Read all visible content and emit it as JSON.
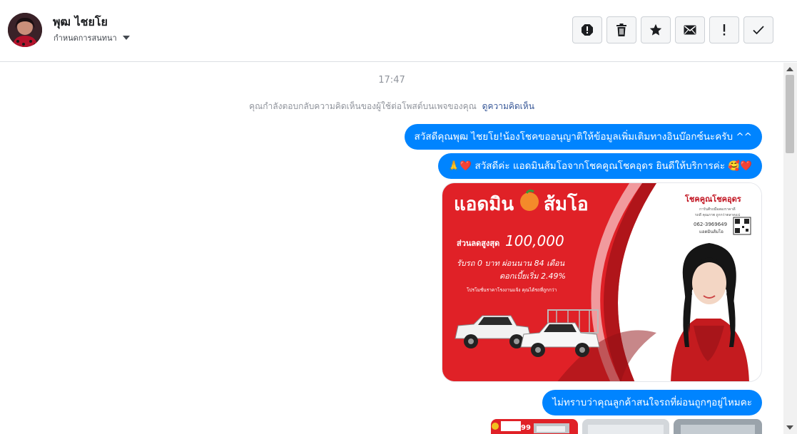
{
  "header": {
    "name": "พุฒ ไชยโย",
    "subtitle": "กำหนดการสนทนา",
    "actions": [
      {
        "icon": "alert-circle-icon",
        "name": "report-button"
      },
      {
        "icon": "trash-icon",
        "name": "delete-button"
      },
      {
        "icon": "star-icon",
        "name": "star-button"
      },
      {
        "icon": "envelope-icon",
        "name": "mark-unread-button"
      },
      {
        "icon": "exclamation-icon",
        "name": "spam-button"
      },
      {
        "icon": "check-icon",
        "name": "done-button"
      }
    ]
  },
  "thread": {
    "timestamp": "17:47",
    "context_text": "คุณกำลังตอบกลับความคิดเห็นของผู้ใช้ต่อโพสต์บนเพจของคุณ",
    "context_link": "ดูความคิดเห็น",
    "messages": [
      {
        "text": "สวัสดีคุณพุฒ ไชยโย!น้องโชคขออนุญาติให้ข้อมูลเพิ่มเติมทางอินบ๊อกซ์นะครับ ^^"
      },
      {
        "text": "🙏❤️ สวัสดีค่ะ แอดมินส้มโอจากโชคคูณโชคอุดร ยินดีให้บริการค่ะ 🥰❤️"
      },
      {
        "text": "ไม่ทราบว่าคุณลูกค้าสนใจรถที่ผ่อนถูกๆอยู่ไหมคะ"
      }
    ],
    "promo": {
      "brand": "โชคคูณโชคอุดร",
      "brand_sub": "การันตีรถมือสองราคาดี",
      "brand_sub2": "รถดี คุณภาพ ถูกกว่าตลาดแน่",
      "phone": "062-3969649",
      "admin": "แอดมินส้มโอ",
      "headline_left": "แอดมิน",
      "headline_right": "ส้มโอ",
      "discount_label": "ส่วนลดสูงสุด",
      "discount_value": "100,000",
      "line2": "รับรถ 0 บาท ผ่อนนาน 84 เดือน",
      "line3": "ดอกเบี้ยเริ่ม 2.49%",
      "line4": "โปรโมชั่นราคาโรงงานแจ้ง คุณได้รถที่ถูกกว่า"
    },
    "thumb_badge": "99"
  },
  "colors": {
    "bubble": "#0084ff",
    "promo_red": "#e02127",
    "link": "#385898"
  }
}
